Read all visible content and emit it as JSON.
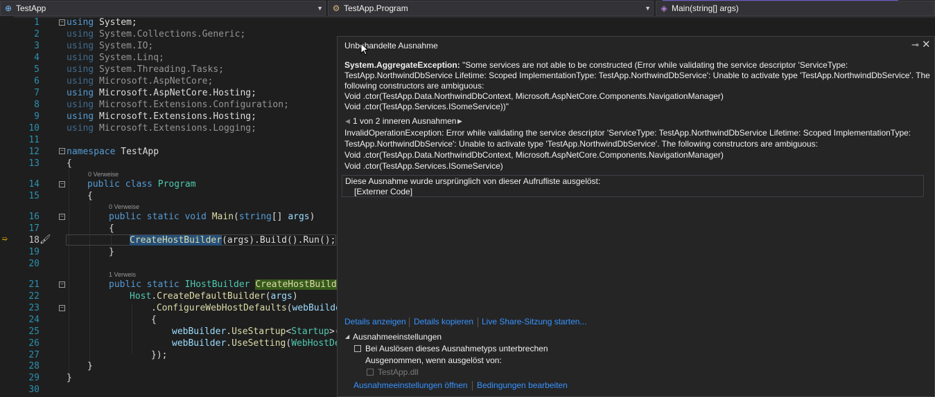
{
  "navbar": {
    "project": "TestApp",
    "class": "TestApp.Program",
    "member": "Main(string[] args)"
  },
  "editor": {
    "line_numbers": [
      "1",
      "2",
      "3",
      "4",
      "5",
      "6",
      "7",
      "8",
      "9",
      "10",
      "11",
      "12",
      "13",
      "14",
      "15",
      "16",
      "17",
      "18",
      "19",
      "20",
      "21",
      "22",
      "23",
      "24",
      "25",
      "26",
      "27",
      "28",
      "29",
      "30"
    ],
    "codelens": {
      "program": "0 Verweise",
      "main": "0 Verweise",
      "create": "1 Verweis"
    },
    "usings": {
      "kw": "using",
      "l1": "System;",
      "l2": "System.Collections.Generic;",
      "l3": "System.IO;",
      "l4": "System.Linq;",
      "l5": "System.Threading.Tasks;",
      "l6": "Microsoft.AspNetCore;",
      "l7a": "Microsoft",
      "l7b": ".AspNetCore.",
      "l7c": "Hosting",
      "l7d": ";",
      "l8": "Microsoft.Extensions.Configuration;",
      "l9a": "Microsoft",
      "l9b": ".Extensions.",
      "l9c": "Hosting",
      "l9d": ";",
      "l10": "Microsoft.Extensions.Logging;"
    },
    "l12": {
      "kw": "namespace",
      "name": "TestApp"
    },
    "brace_open": "{",
    "brace_close": "}",
    "l14": {
      "kw": "public class",
      "name": "Program"
    },
    "l16": {
      "kw": "public static void",
      "name": "Main",
      "p1": "(",
      "type": "string",
      "p2": "[] ",
      "arg": "args",
      "p3": ")"
    },
    "l18": {
      "call": "CreateHostBuilder",
      "rest": "(args).Build().Run();"
    },
    "l21": {
      "kw": "public static",
      "type": "IHostBuilder",
      "name": "CreateHostBuilder"
    },
    "l22": {
      "host": "Host",
      "dot": ".",
      "method": "CreateDefaultBuilder",
      "p1": "(",
      "arg": "args",
      "p2": ")"
    },
    "l23": {
      "dot": ".",
      "method": "ConfigureWebHostDefaults",
      "p1": "(",
      "arg": "webBuilder"
    },
    "l25": {
      "obj": "webBuilder",
      "dot": ".",
      "method": "UseStartup",
      "lt": "<",
      "type": "Startup",
      "rest": ">("
    },
    "l26": {
      "obj": "webBuilder",
      "dot": ".",
      "method": "UseSetting",
      "p1": "(",
      "type": "WebHostDe"
    },
    "l27": "});"
  },
  "exception": {
    "title": "Unbehandelte Ausnahme",
    "type": "System.AggregateException:",
    "msg1": "\"Some services are not able to be constructed (Error while validating the service descriptor 'ServiceType:",
    "msg2": "TestApp.NorthwindDbService Lifetime: Scoped ImplementationType: TestApp.NorthwindDbService': Unable to activate type 'TestApp.NorthwindDbService'. The",
    "msg3": "following constructors are ambiguous:",
    "msg4": "Void .ctor(TestApp.Data.NorthwindDbContext, Microsoft.AspNetCore.Components.NavigationManager)",
    "msg5": "Void .ctor(TestApp.Services.ISomeService))\"",
    "inner_nav": "1 von 2 inneren Ausnahmen",
    "inner1": "InvalidOperationException: Error while validating the service descriptor 'ServiceType: TestApp.NorthwindDbService Lifetime: Scoped ImplementationType:",
    "inner2": "TestApp.NorthwindDbService': Unable to activate type 'TestApp.NorthwindDbService'. The following constructors are ambiguous:",
    "inner3": "Void .ctor(TestApp.Data.NorthwindDbContext, Microsoft.AspNetCore.Components.NavigationManager)",
    "inner4": "Void .ctor(TestApp.Services.ISomeService)",
    "stack_header": "Diese Ausnahme wurde ursprünglich von dieser Aufrufliste ausgelöst:",
    "stack_item": "[Externer Code]",
    "links": {
      "details": "Details anzeigen",
      "copy": "Details kopieren",
      "liveshare": "Live Share-Sitzung starten..."
    },
    "settings": {
      "header": "Ausnahmeeinstellungen",
      "break_label": "Bei Auslösen dieses Ausnahmetyps unterbrechen",
      "except_label": "Ausgenommen, wenn ausgelöst von:",
      "dll": "TestApp.dll",
      "open_link": "Ausnahmeeinstellungen öffnen",
      "cond_link": "Bedingungen bearbeiten"
    }
  }
}
